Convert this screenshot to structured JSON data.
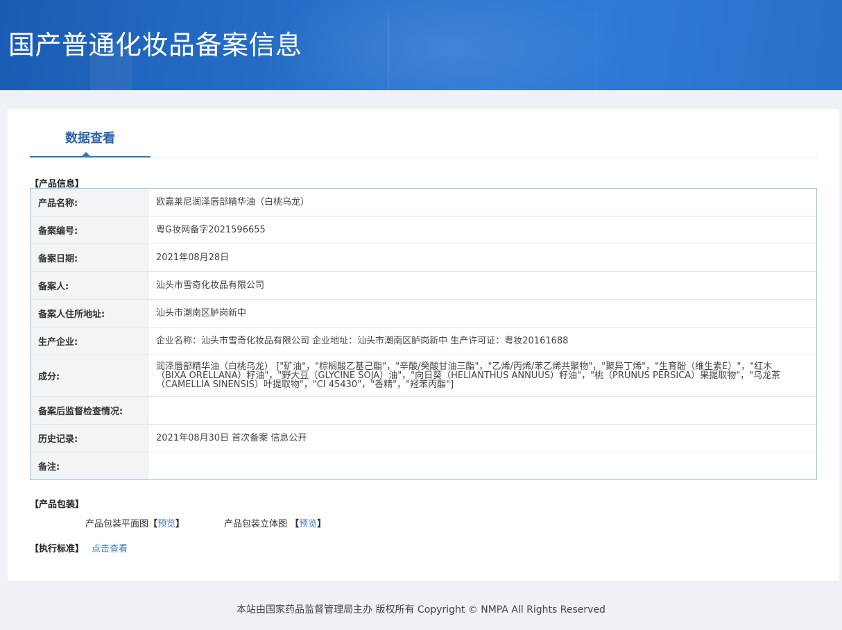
{
  "banner": {
    "title": "国产普通化妆品备案信息"
  },
  "tabs": {
    "active_label": "数据查看"
  },
  "product_info": {
    "section_title": "【产品信息】",
    "rows": [
      {
        "key": "产品名称:",
        "value": "欧嘉莱尼润泽唇部精华油（白桃乌龙）"
      },
      {
        "key": "备案编号:",
        "value": "粤G妆网备字2021596655"
      },
      {
        "key": "备案日期:",
        "value": "2021年08月28日"
      },
      {
        "key": "备案人:",
        "value": "汕头市雪奇化妆品有限公司"
      },
      {
        "key": "备案人住所地址:",
        "value": "汕头市潮南区胪岗新中"
      },
      {
        "key": "生产企业:",
        "value": "企业名称：汕头市雪奇化妆品有限公司 企业地址：汕头市潮南区胪岗新中 生产许可证：粤妆20161688"
      },
      {
        "key": "成分:",
        "value": "润泽唇部精华油（白桃乌龙） [\"矿油\"，\"棕榈酸乙基己酯\"，\"辛酸/癸酸甘油三酯\"，\"乙烯/丙烯/苯乙烯共聚物\"，\"聚异丁烯\"，\"生育酚（维生素E）\"，\"红木（BIXA ORELLANA）籽油\"，\"野大豆（GLYCINE SOJA）油\"，\"向日葵（HELIANTHUS ANNUUS）籽油\"，\"桃（PRUNUS PERSICA）果提取物\"，\"乌龙茶（CAMELLIA SINENSIS）叶提取物\"，\"CI 45430\"，\"香精\"，\"羟苯丙酯\"]"
      },
      {
        "key": "备案后监督检查情况:",
        "value": ""
      },
      {
        "key": "历史记录:",
        "value": "2021年08月30日 首次备案 信息公开"
      },
      {
        "key": "备注:",
        "value": ""
      }
    ]
  },
  "packaging": {
    "section_title": "【产品包装】",
    "flat_label": "产品包装平面图",
    "stereo_label": "产品包装立体图",
    "bracket_open": "【",
    "bracket_close": "】",
    "preview_label": "预览"
  },
  "standard": {
    "section_title": "【执行标准】",
    "link_label": "点击查看"
  },
  "footer": {
    "text": "本站由国家药品监督管理局主办 版权所有 Copyright © NMPA All Rights Reserved"
  }
}
